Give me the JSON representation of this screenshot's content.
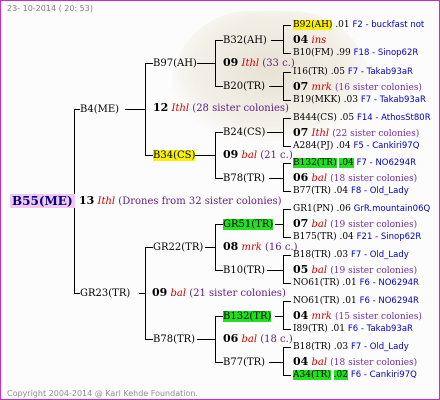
{
  "header_date": "23- 10-2014 ( 20: 53)",
  "footer": "Copyright 2004-2014 @ Karl Kehde Foundation.",
  "colors": {
    "border": "#c030c0",
    "root_bg": "#f0c8f0",
    "highlight_yellow": "#f8f000",
    "highlight_green": "#20e020"
  },
  "root": {
    "name": "B55(ME)",
    "gen": "13",
    "race": "Ithl",
    "sisters": "(Drones from 32 sister colonies)"
  },
  "p1": {
    "name": "B4(ME)",
    "gen": "12",
    "race": "Ithl",
    "sisters": "(28 sister colonies)",
    "p": {
      "name": "B97(AH)",
      "p": {
        "name": "B32(AH)",
        "gen": "09",
        "race": "Ithl",
        "sisters": "(33 c.)",
        "r1": {
          "name": "B92(AH)",
          "val": ".01",
          "info": "F2 - buckfast not"
        },
        "r2": {
          "gen": "04",
          "race": "ins"
        },
        "r3": {
          "name": "B10(FM)",
          "val": ".99",
          "info": "F18 - Sinop62R"
        }
      },
      "m": {
        "name": "B20(TR)",
        "gen": "07",
        "race": "mrk",
        "sisters": "(16 sister colonies)",
        "r1": {
          "name": "I16(TR)",
          "val": ".05",
          "info": "F7 - Takab93aR"
        },
        "r3": {
          "name": "B19(MKK)",
          "val": ".03",
          "info": "F7 - Takab93aR"
        }
      }
    },
    "m": {
      "name": "B34(CS)",
      "p": {
        "name": "B24(CS)",
        "gen": "07",
        "race": "Ithl",
        "sisters": "(22 sister colonies)",
        "r1": {
          "name": "B444(CS)",
          "val": ".05",
          "info": "F14 - AthosSt80R"
        },
        "r3": {
          "name": "A284(PJ)",
          "val": ".04",
          "info": "F5 - Cankiri97Q"
        }
      },
      "gen": "09",
      "race": "bal",
      "sisters": "(21 c.)",
      "m": {
        "name": "B78(TR)",
        "gen": "06",
        "race": "bal",
        "sisters": "(18 sister colonies)",
        "r1": {
          "name": "B132(TR)",
          "val": ".04",
          "info": "F7 - NO6294R"
        },
        "r3": {
          "name": "B77(TR)",
          "val": ".04",
          "info": "F8 - Old_Lady"
        }
      }
    }
  },
  "p2": {
    "name": "GR23(TR)",
    "gen": "09",
    "race": "bal",
    "sisters": "(21 sister colonies)",
    "p": {
      "name": "GR22(TR)",
      "gen": "08",
      "race": "mrk",
      "sisters": "(16 c.)",
      "p": {
        "name": "GR51(TR)",
        "gen": "07",
        "race": "bal",
        "sisters": "(19 sister colonies)",
        "r1": {
          "name": "GR1(PN)",
          "val": ".06",
          "info": "GrR.mountain06Q"
        },
        "r3": {
          "name": "B175(TR)",
          "val": ".04",
          "info": "F21 - Sinop62R"
        }
      },
      "m": {
        "name": "B10(TR)",
        "gen": "05",
        "race": "bal",
        "sisters": "(19 sister colonies)",
        "r1": {
          "name": "B18(TR)",
          "val": ".03",
          "info": "F7 - Old_Lady"
        },
        "r3": {
          "name": "NO61(TR)",
          "val": ".01",
          "info": "F6 - NO6294R"
        }
      }
    },
    "m": {
      "name": "B78(TR)",
      "gen": "06",
      "race": "bal",
      "sisters": "(18 c.)",
      "p": {
        "name": "B132(TR)",
        "gen": "04",
        "race": "mrk",
        "sisters": "(15 sister colonies)",
        "r1": {
          "name": "NO61(TR)",
          "val": ".01",
          "info": "F6 - NO6294R"
        },
        "r3": {
          "name": "I89(TR)",
          "val": ".01",
          "info": "F6 - Takab93aR"
        }
      },
      "m": {
        "name": "B77(TR)",
        "gen": "04",
        "race": "bal",
        "sisters": "(18 sister colonies)",
        "r1": {
          "name": "B18(TR)",
          "val": ".03",
          "info": "F7 - Old_Lady"
        },
        "r3": {
          "name": "A34(TR)",
          "val": ".02",
          "info": "F6 - Cankiri97Q"
        }
      }
    }
  }
}
